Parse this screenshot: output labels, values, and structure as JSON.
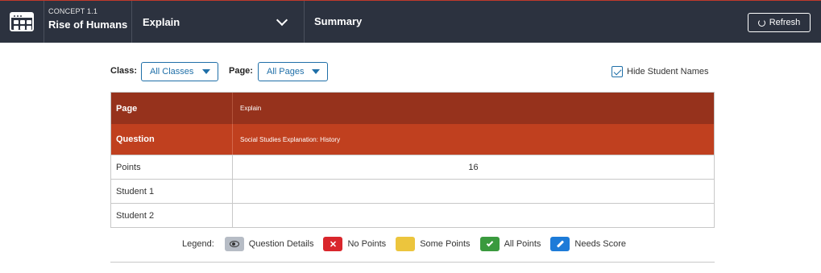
{
  "header": {
    "concept_label": "CONCEPT 1.1",
    "concept_title": "Rise of Humans",
    "page_selector": "Explain",
    "summary_tab": "Summary",
    "refresh_label": "Refresh"
  },
  "filters": {
    "class_label": "Class:",
    "class_value": "All Classes",
    "page_label": "Page:",
    "page_value": "All Pages",
    "hide_names_label": "Hide Student Names",
    "hide_names_checked": true
  },
  "table": {
    "page_label": "Page",
    "page_value": "Explain",
    "question_label": "Question",
    "question_value": "Social Studies Explanation: History",
    "points_label": "Points",
    "points_value": "16",
    "students": [
      "Student 1",
      "Student 2"
    ]
  },
  "legend": {
    "label": "Legend:",
    "items": [
      "Question Details",
      "No Points",
      "Some Points",
      "All Points",
      "Needs Score"
    ],
    "colors": {
      "question_details": "#b6bcc5",
      "no_points": "#d9262c",
      "some_points": "#ecc53d",
      "all_points": "#3a9a3e",
      "needs_score": "#1d7bd8"
    },
    "icons": [
      "eye-icon",
      "x-icon",
      "none",
      "check-icon",
      "pencil-icon"
    ]
  },
  "colors": {
    "topbar": "#2c323f",
    "page_row": "#96321c",
    "question_row": "#c0401f",
    "accent_blue": "#1f6fa8"
  }
}
